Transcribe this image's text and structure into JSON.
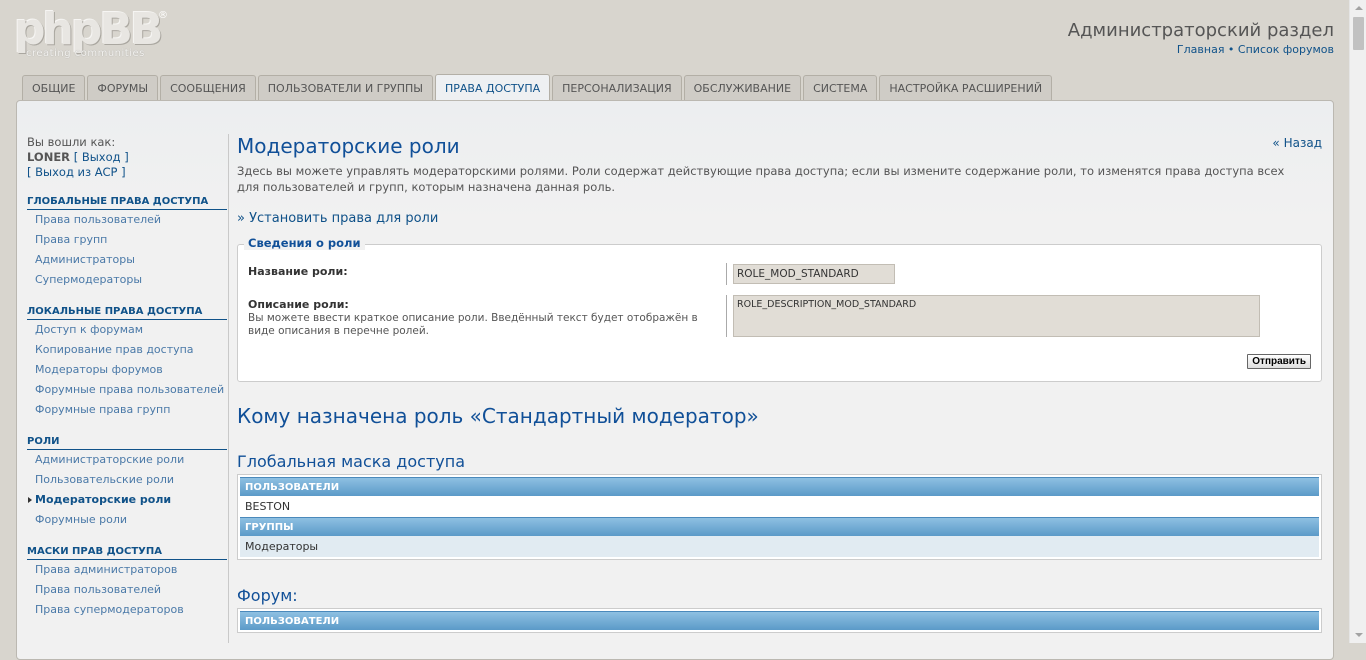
{
  "header": {
    "logo_text": "phpBB",
    "logo_tagline": "creating  communities",
    "logo_reg": "®",
    "site_title": "Администраторский раздел",
    "links": {
      "home": "Главная",
      "separator": " • ",
      "forum_list": "Список форумов"
    }
  },
  "tabs": [
    {
      "label": "Общие"
    },
    {
      "label": "Форумы"
    },
    {
      "label": "Сообщения"
    },
    {
      "label": "Пользователи и группы"
    },
    {
      "label": "Права доступа",
      "active": true
    },
    {
      "label": "Персонализация"
    },
    {
      "label": "Обслуживание"
    },
    {
      "label": "Система"
    },
    {
      "label": "Настройка расширений"
    }
  ],
  "sidebar": {
    "logged_in_as": "Вы вошли как:",
    "username": "LONER",
    "logout": "[ Выход ]",
    "acp_logout": "[ Выход из ACP ]",
    "groups": [
      {
        "title": "Глобальные права доступа",
        "items": [
          "Права пользователей",
          "Права групп",
          "Администраторы",
          "Супермодераторы"
        ]
      },
      {
        "title": "Локальные права доступа",
        "items": [
          "Доступ к форумам",
          "Копирование прав доступа",
          "Модераторы форумов",
          "Форумные права пользователей",
          "Форумные права групп"
        ]
      },
      {
        "title": "Роли",
        "items": [
          "Администраторские роли",
          "Пользовательские роли",
          "Модераторские роли",
          "Форумные роли"
        ]
      },
      {
        "title": "Маски прав доступа",
        "items": [
          "Права администраторов",
          "Права пользователей",
          "Права супермодераторов"
        ]
      }
    ]
  },
  "content": {
    "title": "Модераторские роли",
    "back": "« Назад",
    "intro": "Здесь вы можете управлять модераторскими ролями. Роли содержат действующие права доступа; если вы измените содержание роли, то изменятся права доступа всех для пользователей и групп, которым назначена данная роль.",
    "set_perms": "» Установить права для роли",
    "role_info": {
      "legend": "Сведения о роли",
      "name_label": "Название роли:",
      "name_value": "ROLE_MOD_STANDARD",
      "desc_label": "Описание роли:",
      "desc_explain": "Вы можете ввести краткое описание роли. Введённый текст будет отображён в виде описания в перечне ролей.",
      "desc_value": "ROLE_DESCRIPTION_MOD_STANDARD",
      "submit": "Отправить"
    },
    "assigned_title": "Кому назначена роль «Стандартный модератор»",
    "global_mask": {
      "title": "Глобальная маска доступа",
      "users_head": "Пользователи",
      "users": [
        "BESTON"
      ],
      "groups_head": "Группы",
      "groups": [
        "Модераторы"
      ]
    },
    "forum_mask": {
      "title": "Форум:",
      "users_head": "Пользователи"
    }
  }
}
